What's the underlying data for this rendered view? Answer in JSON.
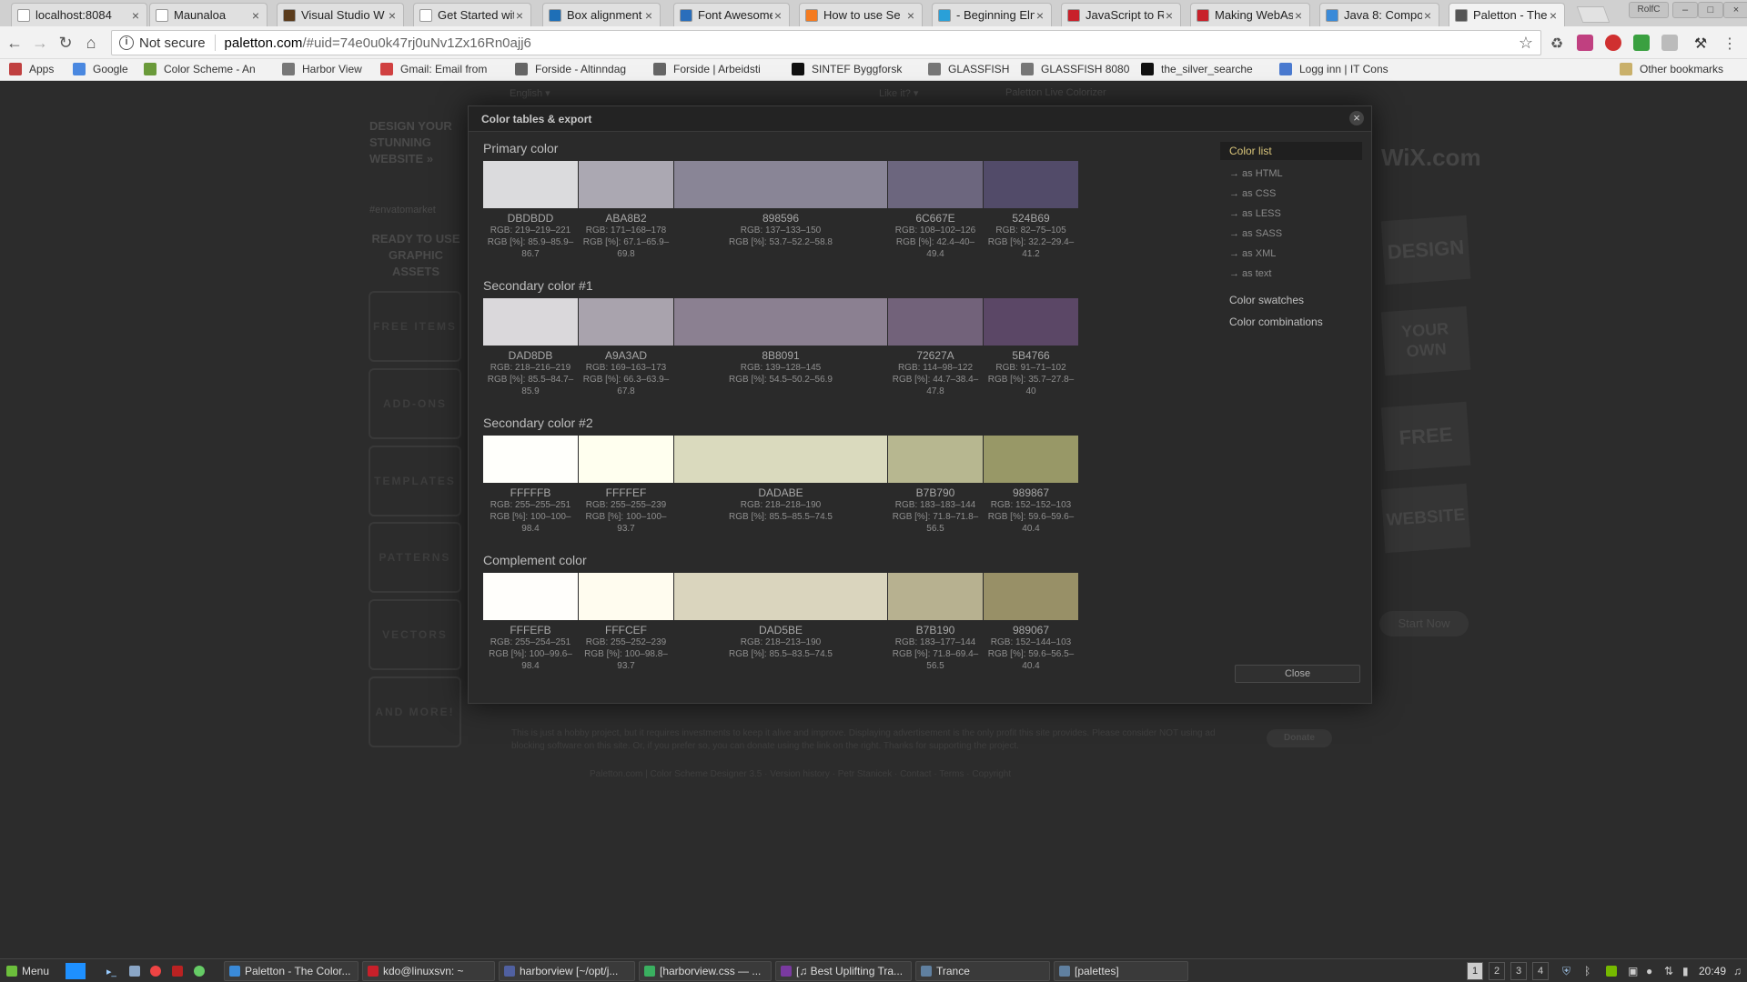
{
  "browser": {
    "tabs": [
      {
        "title": "localhost:8084",
        "color": "#ffffff"
      },
      {
        "title": "Maunaloa",
        "color": "#ffffff"
      },
      {
        "title": "Visual Studio W",
        "color": "#5b3c1c"
      },
      {
        "title": "Get Started wit",
        "color": "#ffffff"
      },
      {
        "title": "Box alignment",
        "color": "#1e6fb7"
      },
      {
        "title": "Font Awesome",
        "color": "#2a6ebb"
      },
      {
        "title": "How to use Se",
        "color": "#f47b20"
      },
      {
        "title": "- Beginning Eln",
        "color": "#2aa0d8"
      },
      {
        "title": "JavaScript to R",
        "color": "#c8202a"
      },
      {
        "title": "Making WebAs",
        "color": "#c8202a"
      },
      {
        "title": "Java 8: Compo",
        "color": "#3a8ad8"
      },
      {
        "title": "Paletton - The C",
        "color": "#555555"
      }
    ],
    "tab_close": "×",
    "profile": "RolfC",
    "window_controls": [
      "–",
      "□",
      "×"
    ],
    "url_not_secure": "Not secure",
    "url_host": "paletton.com",
    "url_path": "/#uid=74e0u0k47rj0uNv1Zx16Rn0ajj6",
    "bookmarks": [
      {
        "label": "Apps",
        "icon": "apps-grid-icon"
      },
      {
        "label": "Google",
        "icon": "google-icon"
      },
      {
        "label": "Color Scheme - An",
        "icon": "color-scheme-icon"
      },
      {
        "label": "Harbor View",
        "icon": "page-icon"
      },
      {
        "label": "Gmail: Email from",
        "icon": "gmail-icon"
      },
      {
        "label": "Forside - Altinndag",
        "icon": "altinn-icon"
      },
      {
        "label": "Forside | Arbeidsti",
        "icon": "arbeidstilsynet-icon"
      },
      {
        "label": "SINTEF Byggforsk",
        "icon": "sintef-icon"
      },
      {
        "label": "GLASSFISH",
        "icon": "page-icon"
      },
      {
        "label": "GLASSFISH 8080",
        "icon": "page-icon"
      },
      {
        "label": "the_silver_searche",
        "icon": "github-icon"
      },
      {
        "label": "Logg inn | IT Cons",
        "icon": "itcons-icon"
      }
    ],
    "other_bookmarks": "Other bookmarks"
  },
  "backdrop": {
    "top_links": [
      "English ▾",
      "Like it? ▾",
      "Paletton Live Colorizer"
    ],
    "left_promo": "DESIGN YOUR STUNNING WEBSITE »",
    "envato": "#envatomarket",
    "ready": "READY TO USE GRAPHIC ASSETS",
    "side_buttons": [
      "FREE ITEMS",
      "ADD-ONS",
      "TEMPLATES",
      "PATTERNS",
      "VECTORS",
      "AND MORE!"
    ],
    "wix_logo": "WiX.com",
    "wix_words": [
      "DESIGN",
      "YOUR OWN",
      "FREE",
      "WEBSITE"
    ],
    "start_now": "Start Now",
    "footer_note": "This is just a hobby project, but it requires investments to keep it alive and improve. Displaying advertisement is the only profit this site provides. Please consider NOT using ad blocking software on this site. Or, if you prefer so, you can donate using the link on the right. Thanks for supporting the project.",
    "donate": "Donate",
    "credits": "Paletton.com | Color Scheme Designer 3.5 · Version history · Petr Stanicek · Contact · Terms · Copyright"
  },
  "modal": {
    "title": "Color tables & export",
    "close_x": "×",
    "groups": [
      {
        "name": "Primary color",
        "colors": [
          {
            "hex": "DBDBDD",
            "rgb": "RGB: 219–219–221",
            "pct": "RGB [%]: 85.9–85.9–86.7",
            "fill": "#DBDBDD"
          },
          {
            "hex": "ABA8B2",
            "rgb": "RGB: 171–168–178",
            "pct": "RGB [%]: 67.1–65.9–69.8",
            "fill": "#ABA8B2"
          },
          {
            "hex": "898596",
            "rgb": "RGB: 137–133–150",
            "pct": "RGB [%]: 53.7–52.2–58.8",
            "fill": "#898596"
          },
          {
            "hex": "6C667E",
            "rgb": "RGB: 108–102–126",
            "pct": "RGB [%]: 42.4–40–49.4",
            "fill": "#6C667E"
          },
          {
            "hex": "524B69",
            "rgb": "RGB: 82–75–105",
            "pct": "RGB [%]: 32.2–29.4–41.2",
            "fill": "#524B69"
          }
        ]
      },
      {
        "name": "Secondary color #1",
        "colors": [
          {
            "hex": "DAD8DB",
            "rgb": "RGB: 218–216–219",
            "pct": "RGB [%]: 85.5–84.7–85.9",
            "fill": "#DAD8DB"
          },
          {
            "hex": "A9A3AD",
            "rgb": "RGB: 169–163–173",
            "pct": "RGB [%]: 66.3–63.9–67.8",
            "fill": "#A9A3AD"
          },
          {
            "hex": "8B8091",
            "rgb": "RGB: 139–128–145",
            "pct": "RGB [%]: 54.5–50.2–56.9",
            "fill": "#8B8091"
          },
          {
            "hex": "72627A",
            "rgb": "RGB: 114–98–122",
            "pct": "RGB [%]: 44.7–38.4–47.8",
            "fill": "#72627A"
          },
          {
            "hex": "5B4766",
            "rgb": "RGB: 91–71–102",
            "pct": "RGB [%]: 35.7–27.8–40",
            "fill": "#5B4766"
          }
        ]
      },
      {
        "name": "Secondary color #2",
        "colors": [
          {
            "hex": "FFFFFB",
            "rgb": "RGB: 255–255–251",
            "pct": "RGB [%]: 100–100–98.4",
            "fill": "#FFFFFB"
          },
          {
            "hex": "FFFFEF",
            "rgb": "RGB: 255–255–239",
            "pct": "RGB [%]: 100–100–93.7",
            "fill": "#FFFFEF"
          },
          {
            "hex": "DADABE",
            "rgb": "RGB: 218–218–190",
            "pct": "RGB [%]: 85.5–85.5–74.5",
            "fill": "#DADABE"
          },
          {
            "hex": "B7B790",
            "rgb": "RGB: 183–183–144",
            "pct": "RGB [%]: 71.8–71.8–56.5",
            "fill": "#B7B790"
          },
          {
            "hex": "989867",
            "rgb": "RGB: 152–152–103",
            "pct": "RGB [%]: 59.6–59.6–40.4",
            "fill": "#989867"
          }
        ]
      },
      {
        "name": "Complement color",
        "colors": [
          {
            "hex": "FFFEFB",
            "rgb": "RGB: 255–254–251",
            "pct": "RGB [%]: 100–99.6–98.4",
            "fill": "#FFFEFB"
          },
          {
            "hex": "FFFCEF",
            "rgb": "RGB: 255–252–239",
            "pct": "RGB [%]: 100–98.8–93.7",
            "fill": "#FFFCEF"
          },
          {
            "hex": "DAD5BE",
            "rgb": "RGB: 218–213–190",
            "pct": "RGB [%]: 85.5–83.5–74.5",
            "fill": "#DAD5BE"
          },
          {
            "hex": "B7B190",
            "rgb": "RGB: 183–177–144",
            "pct": "RGB [%]: 71.8–69.4–56.5",
            "fill": "#B7B190"
          },
          {
            "hex": "989067",
            "rgb": "RGB: 152–144–103",
            "pct": "RGB [%]: 59.6–56.5–40.4",
            "fill": "#989067"
          }
        ]
      }
    ],
    "menu": {
      "active": "Color list",
      "sub": [
        "→ as HTML",
        "→ as CSS",
        "→ as LESS",
        "→ as SASS",
        "→ as XML",
        "→ as text"
      ],
      "swatches": "Color swatches",
      "combinations": "Color combinations"
    },
    "close_button": "Close"
  },
  "taskbar": {
    "menu": "Menu",
    "windows": [
      {
        "label": "Paletton - The Color...",
        "color": "#3a8ad8"
      },
      {
        "label": "kdo@linuxsvn: ~",
        "color": "#c8202a"
      },
      {
        "label": "harborview [~/opt/j...",
        "color": "#5060a0"
      },
      {
        "label": "[harborview.css — ...",
        "color": "#3ab060"
      },
      {
        "label": "[♫ Best Uplifting Tra...",
        "color": "#7a3aa0"
      },
      {
        "label": "Trance",
        "color": "#6080a0"
      },
      {
        "label": "[palettes]",
        "color": "#6080a0"
      }
    ],
    "workspaces": [
      "1",
      "2",
      "3",
      "4"
    ],
    "clock": "20:49"
  }
}
